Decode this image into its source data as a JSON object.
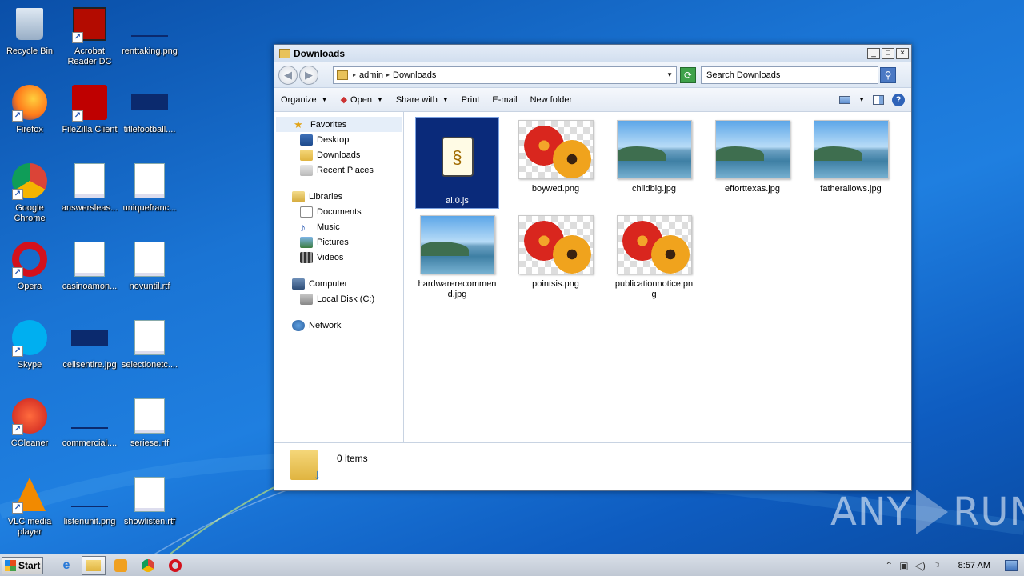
{
  "desktop": {
    "icons": [
      {
        "label": "Recycle Bin",
        "icon": "recycle-bin-icon"
      },
      {
        "label": "Acrobat Reader DC",
        "icon": "acrobat-icon"
      },
      {
        "label": "renttaking.png",
        "icon": "image-file-icon"
      },
      {
        "label": "Firefox",
        "icon": "firefox-icon"
      },
      {
        "label": "FileZilla Client",
        "icon": "filezilla-icon"
      },
      {
        "label": "titlefootball....",
        "icon": "image-file-icon"
      },
      {
        "label": "Google Chrome",
        "icon": "chrome-icon"
      },
      {
        "label": "answersleas...",
        "icon": "word-doc-icon"
      },
      {
        "label": "uniquefranc...",
        "icon": "word-doc-icon"
      },
      {
        "label": "Opera",
        "icon": "opera-icon"
      },
      {
        "label": "casinoamon...",
        "icon": "word-doc-icon"
      },
      {
        "label": "novuntil.rtf",
        "icon": "word-doc-icon"
      },
      {
        "label": "Skype",
        "icon": "skype-icon"
      },
      {
        "label": "cellsentire.jpg",
        "icon": "image-file-icon"
      },
      {
        "label": "selectionetc....",
        "icon": "word-doc-icon"
      },
      {
        "label": "CCleaner",
        "icon": "ccleaner-icon"
      },
      {
        "label": "commercial....",
        "icon": "image-file-icon"
      },
      {
        "label": "seriese.rtf",
        "icon": "word-doc-icon"
      },
      {
        "label": "VLC media player",
        "icon": "vlc-icon"
      },
      {
        "label": "listenunit.png",
        "icon": "image-file-icon"
      },
      {
        "label": "showlisten.rtf",
        "icon": "word-doc-icon"
      }
    ]
  },
  "window": {
    "title": "Downloads",
    "buttons": {
      "minimize": "_",
      "maximize": "□",
      "close": "×"
    },
    "address": {
      "crumbs": [
        "admin",
        "Downloads"
      ]
    },
    "search_placeholder": "Search Downloads",
    "commands": [
      {
        "label": "Organize",
        "caret": "▼"
      },
      {
        "label": "Open",
        "caret": "▼"
      },
      {
        "label": "Share with",
        "caret": "▼"
      },
      {
        "label": "Print"
      },
      {
        "label": "E-mail"
      },
      {
        "label": "New folder"
      }
    ],
    "nav": {
      "favorites": "Favorites",
      "favorites_items": [
        "Desktop",
        "Downloads",
        "Recent Places"
      ],
      "libraries": "Libraries",
      "libraries_items": [
        "Documents",
        "Music",
        "Pictures",
        "Videos"
      ],
      "computer": "Computer",
      "computer_items": [
        "Local Disk (C:)"
      ],
      "network": "Network"
    },
    "files": [
      {
        "name": "ai.0.js",
        "type": "script"
      },
      {
        "name": "boywed.png",
        "type": "flower"
      },
      {
        "name": "childbig.jpg",
        "type": "landscape"
      },
      {
        "name": "efforttexas.jpg",
        "type": "landscape"
      },
      {
        "name": "fatherallows.jpg",
        "type": "landscape"
      },
      {
        "name": "hardwarerecommend.jpg",
        "type": "landscape"
      },
      {
        "name": "pointsis.png",
        "type": "flower"
      },
      {
        "name": "publicationnotice.png",
        "type": "flower"
      }
    ],
    "details": {
      "item_count": "0 items"
    }
  },
  "taskbar": {
    "start_label": "Start",
    "clock": "8:57 AM"
  },
  "watermark": {
    "left": "ANY",
    "right": "RUN"
  }
}
